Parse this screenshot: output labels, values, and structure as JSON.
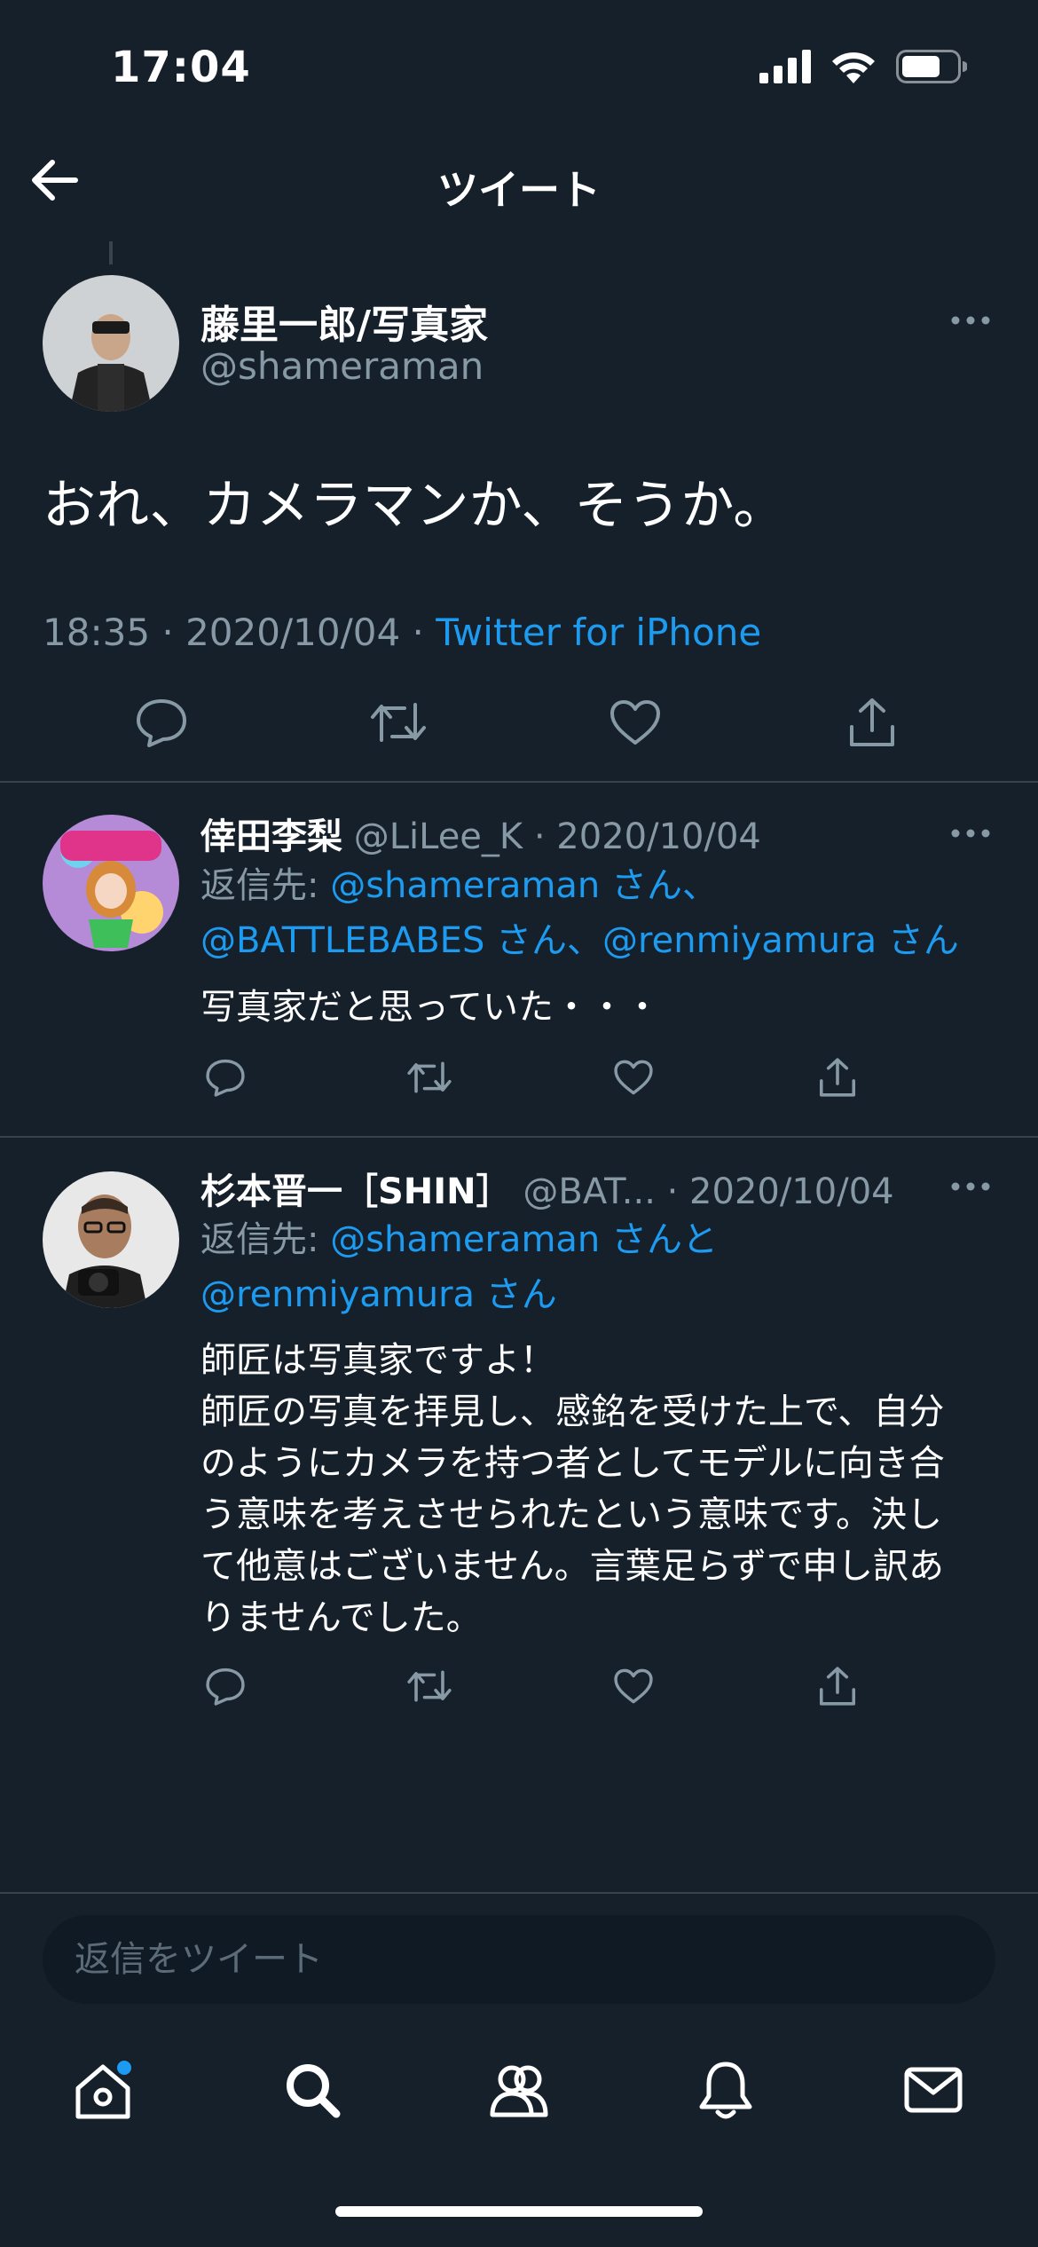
{
  "status_bar": {
    "time": "17:04"
  },
  "nav": {
    "title": "ツイート"
  },
  "main_tweet": {
    "display_name": "藤里一郎/写真家",
    "handle": "@shameraman",
    "text": "おれ、カメラマンか、そうか。",
    "time": "18:35 · 2020/10/04 · ",
    "source": "Twitter for iPhone"
  },
  "replies": [
    {
      "display_name": "倖田李梨",
      "handle": "@LiLee_K",
      "date": "· 2020/10/04",
      "reply_label": "返信先: ",
      "reply_line1_mention": "@shameraman さん、",
      "reply_line2_mention": "@BATTLEBABES さん、@renmiyamura さん",
      "text": "写真家だと思っていた・・・"
    },
    {
      "display_name": "杉本晋一［SHIN］",
      "handle": "@BAT...",
      "date": "· 2020/10/04",
      "reply_label": "返信先: ",
      "reply_line1_mention": "@shameraman さんと",
      "reply_line2_mention": "@renmiyamura さん",
      "text_lines": [
        "師匠は写真家ですよ！",
        "師匠の写真を拝見し、感銘を受けた上で、自分",
        "のようにカメラを持つ者としてモデルに向き合",
        "う意味を考えさせられたという意味です。決し",
        "て他意はございません。言葉足らずで申し訳あ",
        "りませんでした。"
      ]
    }
  ],
  "compose": {
    "placeholder": "返信をツイート"
  },
  "colors": {
    "background": "#15202b",
    "accent": "#1d9bf0",
    "muted": "#8899a6",
    "divider": "#38444d"
  },
  "icons": {
    "status": [
      "cellular-signal-icon",
      "wifi-icon",
      "battery-icon"
    ],
    "nav": [
      "back-arrow-icon"
    ],
    "actions": [
      "reply-icon",
      "retweet-icon",
      "like-icon",
      "share-icon"
    ],
    "tabs": [
      "home-icon",
      "search-icon",
      "communities-icon",
      "notifications-icon",
      "messages-icon"
    ]
  }
}
